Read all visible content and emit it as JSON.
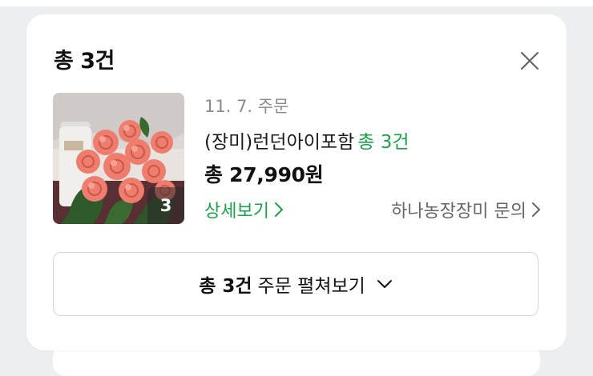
{
  "card": {
    "title": "총 3건"
  },
  "order": {
    "date_label": "11. 7. 주문",
    "product_name": "(장미)런던아이포함",
    "product_count": "총 3건",
    "total_price": "총 27,990원",
    "image_count": "3",
    "detail_label": "상세보기",
    "inquiry_label": "하나농장장미 문의"
  },
  "expand": {
    "strong_label": "총 3건",
    "label": "주문 펼쳐보기"
  },
  "colors": {
    "accent_green": "#18a34a",
    "text_primary": "#111111",
    "text_secondary": "#8a8a8a",
    "background": "#eceef1"
  },
  "icons": {
    "close": "close-icon",
    "chevron_right": "chevron-right-icon",
    "chevron_down": "chevron-down-icon"
  }
}
